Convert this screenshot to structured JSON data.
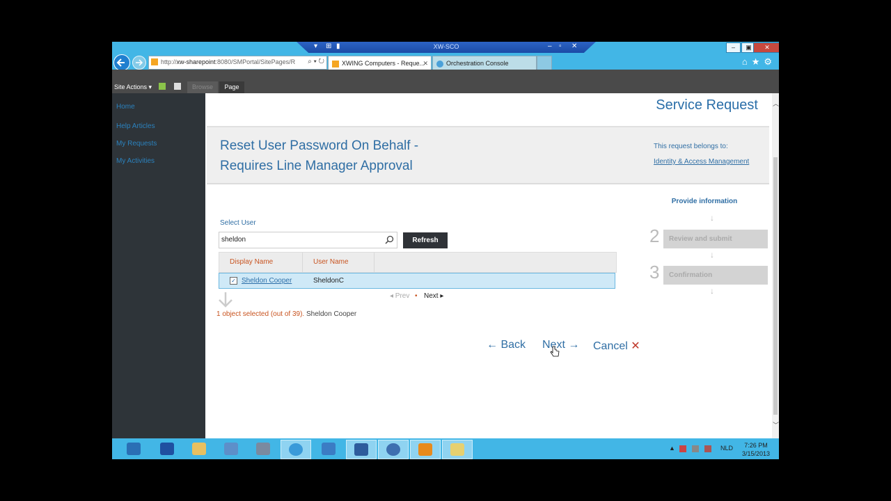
{
  "rdp": {
    "title": "XW-SCO"
  },
  "browser": {
    "url_prefix": "http://",
    "url_host": "xw-sharepoint",
    "url_rest": ":8080/SMPortal/SitePages/R",
    "tabs": [
      {
        "label": "XWING Computers - Reque..."
      },
      {
        "label": "Orchestration Console"
      }
    ]
  },
  "ribbon": {
    "site_actions": "Site Actions ▾",
    "browse": "Browse",
    "page": "Page"
  },
  "nav": {
    "items": [
      "Home",
      "Help Articles",
      "My Requests",
      "My Activities"
    ]
  },
  "page": {
    "service_request": "Service Request",
    "title_line1": "Reset User Password On Behalf -",
    "title_line2": "Requires Line Manager Approval",
    "belongs_label": "This request belongs to:",
    "belongs_link": "Identity & Access Management",
    "select_user_label": "Select User",
    "search_value": "sheldon",
    "refresh_label": "Refresh",
    "columns": [
      "Display Name",
      "User Name"
    ],
    "rows": [
      {
        "display_name": "Sheldon Cooper",
        "user_name": "SheldonC",
        "checked": true
      }
    ],
    "pager_prev": "◂ Prev",
    "pager_dot": "•",
    "pager_next": "Next ▸",
    "selection_status": "1 object selected (out of 39).",
    "selection_names": "Sheldon Cooper",
    "back_label": "← Back",
    "next_label": "Next →",
    "cancel_label": "Cancel"
  },
  "steps": [
    {
      "number": "",
      "label": "Provide information"
    },
    {
      "number": "2",
      "label": "Review and submit"
    },
    {
      "number": "3",
      "label": "Confirmation"
    }
  ],
  "taskbar": {
    "lang": "NLD",
    "time": "7:26 PM",
    "date": "3/15/2013"
  }
}
